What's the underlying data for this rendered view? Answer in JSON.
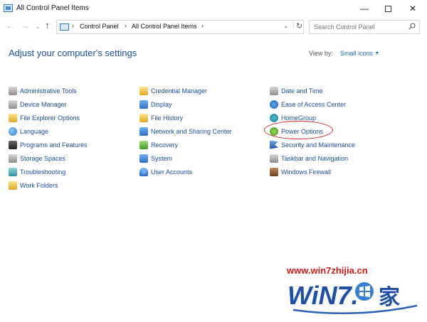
{
  "window": {
    "title": "All Control Panel Items",
    "minimize": "—",
    "close": "✕"
  },
  "nav": {
    "back": "←",
    "forward": "→",
    "up": "↑",
    "recent": "⌄",
    "address": {
      "sep": "›",
      "crumbs": [
        "Control Panel",
        "All Control Panel Items"
      ],
      "dropdown": "⌄",
      "refresh": "↻"
    },
    "search_placeholder": "Search Control Panel"
  },
  "header": {
    "title": "Adjust your computer's settings",
    "view_by_label": "View by:",
    "view_by_value": "Small icons",
    "view_by_caret": "▾"
  },
  "items": {
    "col1": [
      {
        "label": "Administrative Tools",
        "icon": "admin-tools-icon"
      },
      {
        "label": "Device Manager",
        "icon": "device-manager-icon"
      },
      {
        "label": "File Explorer Options",
        "icon": "folder-options-icon"
      },
      {
        "label": "Language",
        "icon": "language-icon"
      },
      {
        "label": "Programs and Features",
        "icon": "programs-icon"
      },
      {
        "label": "Storage Spaces",
        "icon": "storage-icon"
      },
      {
        "label": "Troubleshooting",
        "icon": "troubleshooting-icon"
      },
      {
        "label": "Work Folders",
        "icon": "work-folders-icon"
      }
    ],
    "col2": [
      {
        "label": "Credential Manager",
        "icon": "credential-icon"
      },
      {
        "label": "Display",
        "icon": "display-icon"
      },
      {
        "label": "File History",
        "icon": "file-history-icon"
      },
      {
        "label": "Network and Sharing Center",
        "icon": "network-icon"
      },
      {
        "label": "Recovery",
        "icon": "recovery-icon"
      },
      {
        "label": "System",
        "icon": "system-icon"
      },
      {
        "label": "User Accounts",
        "icon": "user-accounts-icon"
      }
    ],
    "col3": [
      {
        "label": "Date and Time",
        "icon": "date-time-icon"
      },
      {
        "label": "Ease of Access Center",
        "icon": "ease-of-access-icon"
      },
      {
        "label": "HomeGroup",
        "icon": "homegroup-icon"
      },
      {
        "label": "Power Options",
        "icon": "power-options-icon"
      },
      {
        "label": "Security and Maintenance",
        "icon": "flag-icon"
      },
      {
        "label": "Taskbar and Navigation",
        "icon": "taskbar-icon"
      },
      {
        "label": "Windows Firewall",
        "icon": "firewall-icon"
      }
    ]
  },
  "watermark": {
    "url": "www.win7zhijia.cn",
    "logo_text": "WiN7.",
    "logo_suffix": "家"
  },
  "colors": {
    "link": "#1a4e9c",
    "heading": "#1a4e9c",
    "highlight": "#d02a2a",
    "watermark": "#d81818"
  }
}
